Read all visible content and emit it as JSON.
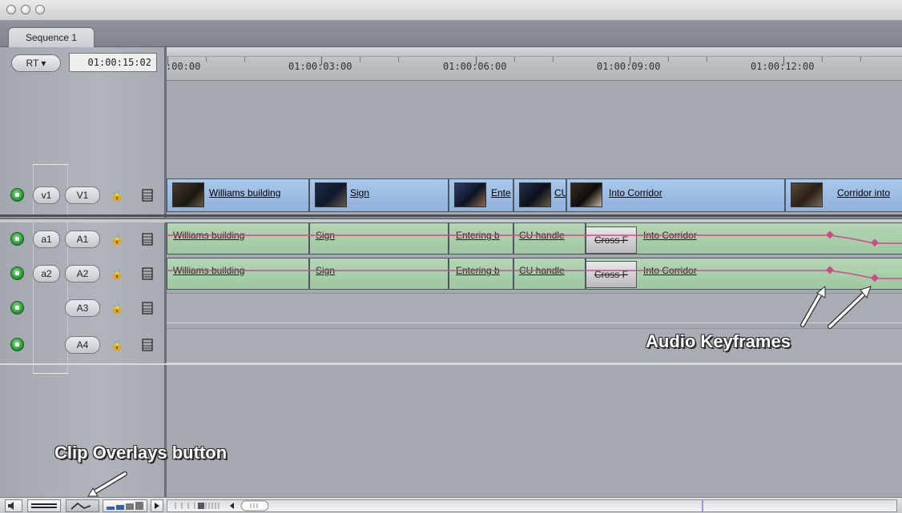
{
  "window": {
    "title_buttons": [
      "close",
      "minimize",
      "zoom"
    ]
  },
  "tab": {
    "label": "Sequence 1"
  },
  "toolbar": {
    "rt_label": "RT ▾",
    "timecode": "01:00:15:02"
  },
  "ruler": {
    "labels": [
      ":00:00",
      "01:00:03:00",
      "01:00:06:00",
      "01:00:09:00",
      "01:00:12:00"
    ]
  },
  "tracks": {
    "video": [
      {
        "source": "v1",
        "dest": "V1"
      }
    ],
    "audio": [
      {
        "source": "a1",
        "dest": "A1"
      },
      {
        "source": "a2",
        "dest": "A2"
      },
      {
        "source": "",
        "dest": "A3"
      },
      {
        "source": "",
        "dest": "A4"
      }
    ],
    "lock_glyph": "🔒",
    "autoselect_glyph": "⊟"
  },
  "clips": {
    "video": [
      {
        "name": "Williams building",
        "thumbnail": true
      },
      {
        "name": "Sign",
        "thumbnail": true
      },
      {
        "name": "Ente",
        "thumbnail": true
      },
      {
        "name": "CU",
        "thumbnail": true
      },
      {
        "name": "Into Corridor",
        "thumbnail": true
      },
      {
        "name": "Corridor into",
        "thumbnail": true
      }
    ],
    "audio_a1": [
      "Williams building",
      "Sign",
      "Entering b",
      "CU handle",
      "Into Corridor"
    ],
    "audio_a2": [
      "Williams building",
      "Sign",
      "Entering b",
      "CU handle",
      "Into Corridor"
    ],
    "transition_a1": "Cross F",
    "transition_a2": "Cross F"
  },
  "annotations": {
    "audio_keyframes": "Audio Keyframes",
    "clip_overlays": "Clip Overlays button"
  },
  "colors": {
    "video_clip": "#9bbce2",
    "audio_clip": "#a8cfaa",
    "keyframe_line": "#d04a8a",
    "enabled_indicator": "#2a9a34"
  }
}
